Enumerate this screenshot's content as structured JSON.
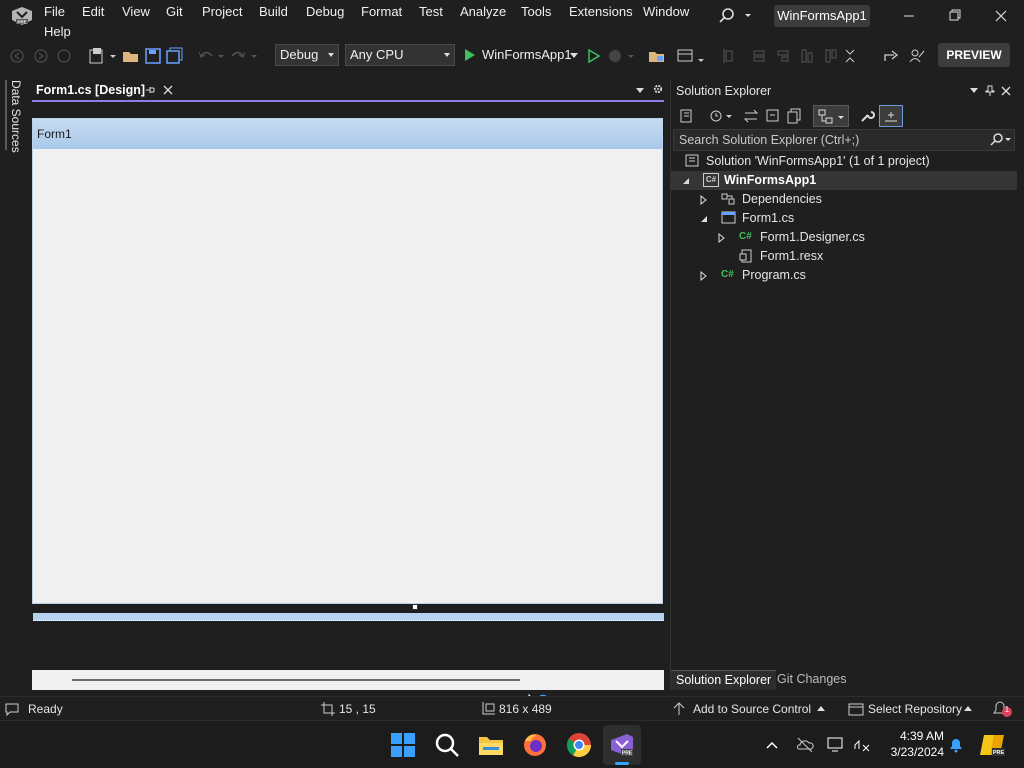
{
  "app": {
    "project_title": "WinFormsApp1",
    "menu": [
      "File",
      "Edit",
      "View",
      "Git",
      "Project",
      "Build",
      "Debug",
      "Format",
      "Test",
      "Analyze",
      "Tools",
      "Extensions",
      "Window",
      "Help"
    ]
  },
  "toolbar": {
    "configuration": "Debug",
    "platform": "Any CPU",
    "start_label": "WinFormsApp1",
    "preview_label": "PREVIEW"
  },
  "left_rail": {
    "data_sources": "Data Sources"
  },
  "document": {
    "tab_label": "Form1.cs [Design]",
    "form_title": "Form1"
  },
  "solution_explorer": {
    "title": "Solution Explorer",
    "search_placeholder": "Search Solution Explorer (Ctrl+;)",
    "tree": [
      {
        "label": "Solution 'WinFormsApp1' (1 of 1 project)",
        "icon": "solution-icon"
      },
      {
        "label": "WinFormsApp1",
        "icon": "csharp-project-icon"
      },
      {
        "label": "Dependencies",
        "icon": "dependencies-icon"
      },
      {
        "label": "Form1.cs",
        "icon": "form-icon"
      },
      {
        "label": "Form1.Designer.cs",
        "icon": "csharp-file-icon"
      },
      {
        "label": "Form1.resx",
        "icon": "resx-file-icon"
      },
      {
        "label": "Program.cs",
        "icon": "csharp-file-icon"
      }
    ],
    "bottom_tabs": [
      "Solution Explorer",
      "Git Changes"
    ]
  },
  "status": {
    "state": "Ready",
    "position": "15 , 15",
    "size": "816 x 489",
    "source_control": "Add to Source Control",
    "repository": "Select Repository"
  },
  "taskbar": {
    "time": "4:39 AM",
    "date": "3/23/2024",
    "notification_count": "1"
  },
  "colors": {
    "accent": "#8b7ee8",
    "form_titlebar": "#b7d2ef",
    "start_green": "#3fbf5f"
  }
}
